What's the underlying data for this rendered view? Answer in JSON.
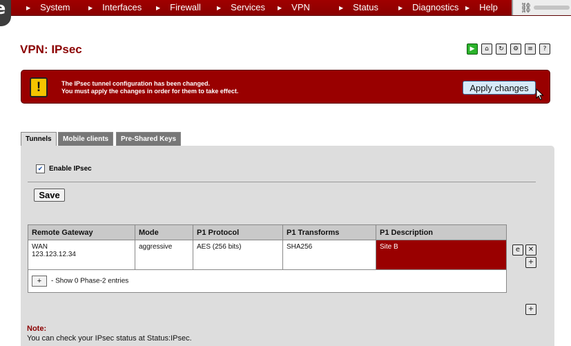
{
  "nav": {
    "items": [
      {
        "label": "System"
      },
      {
        "label": "Interfaces"
      },
      {
        "label": "Firewall"
      },
      {
        "label": "Services"
      },
      {
        "label": "VPN"
      },
      {
        "label": "Status"
      },
      {
        "label": "Diagnostics"
      },
      {
        "label": "Help"
      }
    ]
  },
  "page": {
    "title": "VPN: IPsec"
  },
  "toolbar_icons": [
    "play-icon",
    "home-icon",
    "refresh-icon",
    "settings-icon",
    "log-icon",
    "help-icon"
  ],
  "alert": {
    "line1": "The IPsec tunnel configuration has been changed.",
    "line2": "You must apply the changes in order for them to take effect.",
    "button_label": "Apply changes"
  },
  "tabs": [
    {
      "label": "Tunnels",
      "active": true
    },
    {
      "label": "Mobile clients",
      "active": false
    },
    {
      "label": "Pre-Shared Keys",
      "active": false
    }
  ],
  "enable": {
    "label": "Enable IPsec",
    "checked": true
  },
  "save_label": "Save",
  "table": {
    "headers": [
      "Remote Gateway",
      "Mode",
      "P1 Protocol",
      "P1 Transforms",
      "P1 Description"
    ],
    "rows": [
      {
        "gateway_iface": "WAN",
        "gateway_ip": "123.123.12.34",
        "mode": "aggressive",
        "protocol": "AES (256 bits)",
        "transforms": "SHA256",
        "description": "Site B"
      }
    ],
    "phase2_button": "+",
    "phase2_text": "- Show 0 Phase-2 entries"
  },
  "note": {
    "label": "Note:",
    "text": "You can check your IPsec status at ",
    "link": "Status:IPsec",
    "suffix": "."
  },
  "colors": {
    "brand": "#990000",
    "title": "#8b0000",
    "panel": "#dddddd"
  }
}
